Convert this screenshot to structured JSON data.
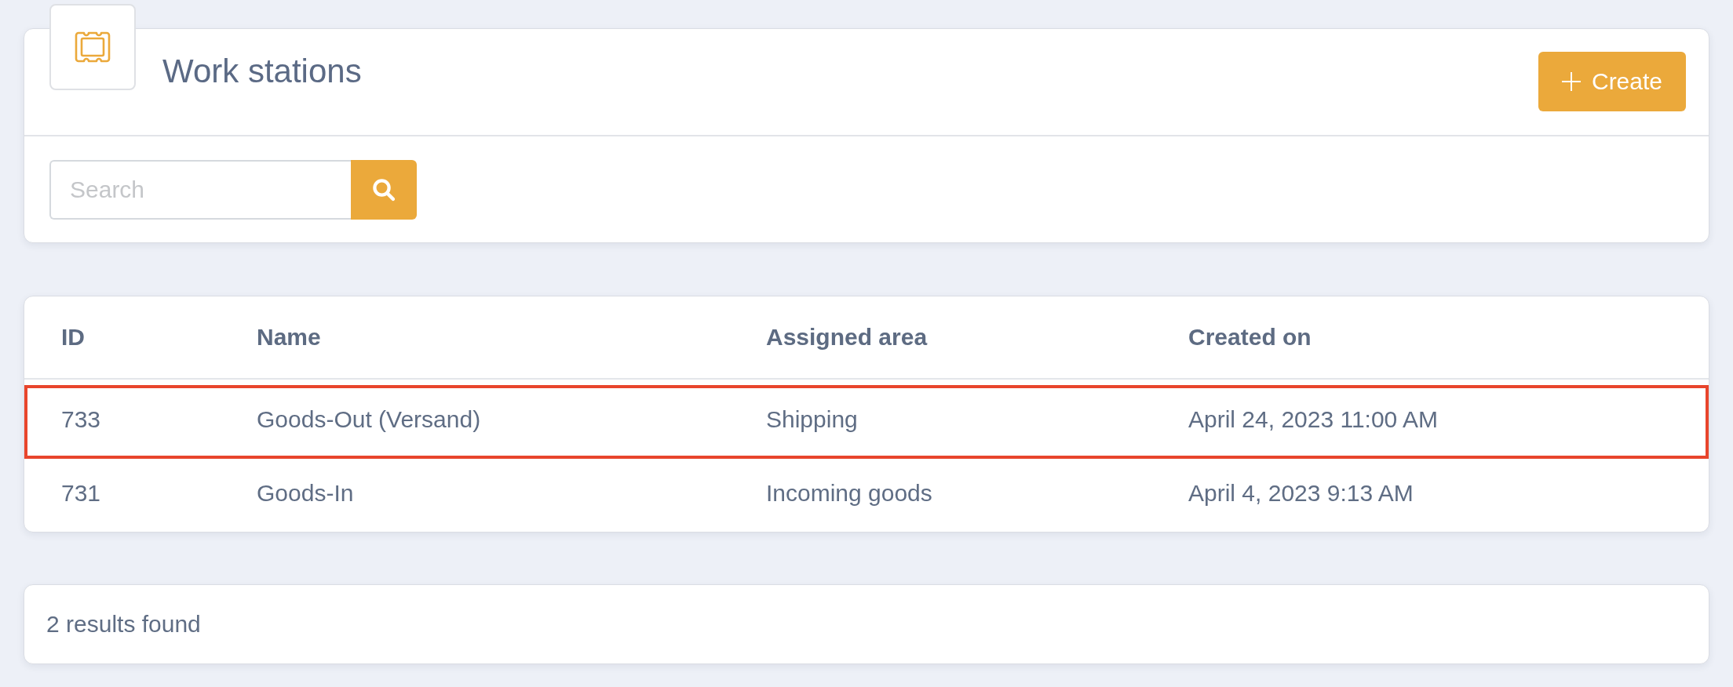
{
  "header": {
    "title": "Work stations",
    "create_button": {
      "label": "Create"
    }
  },
  "search": {
    "placeholder": "Search"
  },
  "table": {
    "columns": [
      "ID",
      "Name",
      "Assigned area",
      "Created on"
    ],
    "rows": [
      {
        "highlighted": true,
        "cells": [
          "733",
          "Goods-Out (Versand)",
          "Shipping",
          "April 24, 2023 11:00 AM"
        ]
      },
      {
        "highlighted": false,
        "cells": [
          "731",
          "Goods-In",
          "Incoming goods",
          "April 4, 2023 9:13 AM"
        ]
      }
    ]
  },
  "footer": {
    "result_count": "2 results found"
  }
}
